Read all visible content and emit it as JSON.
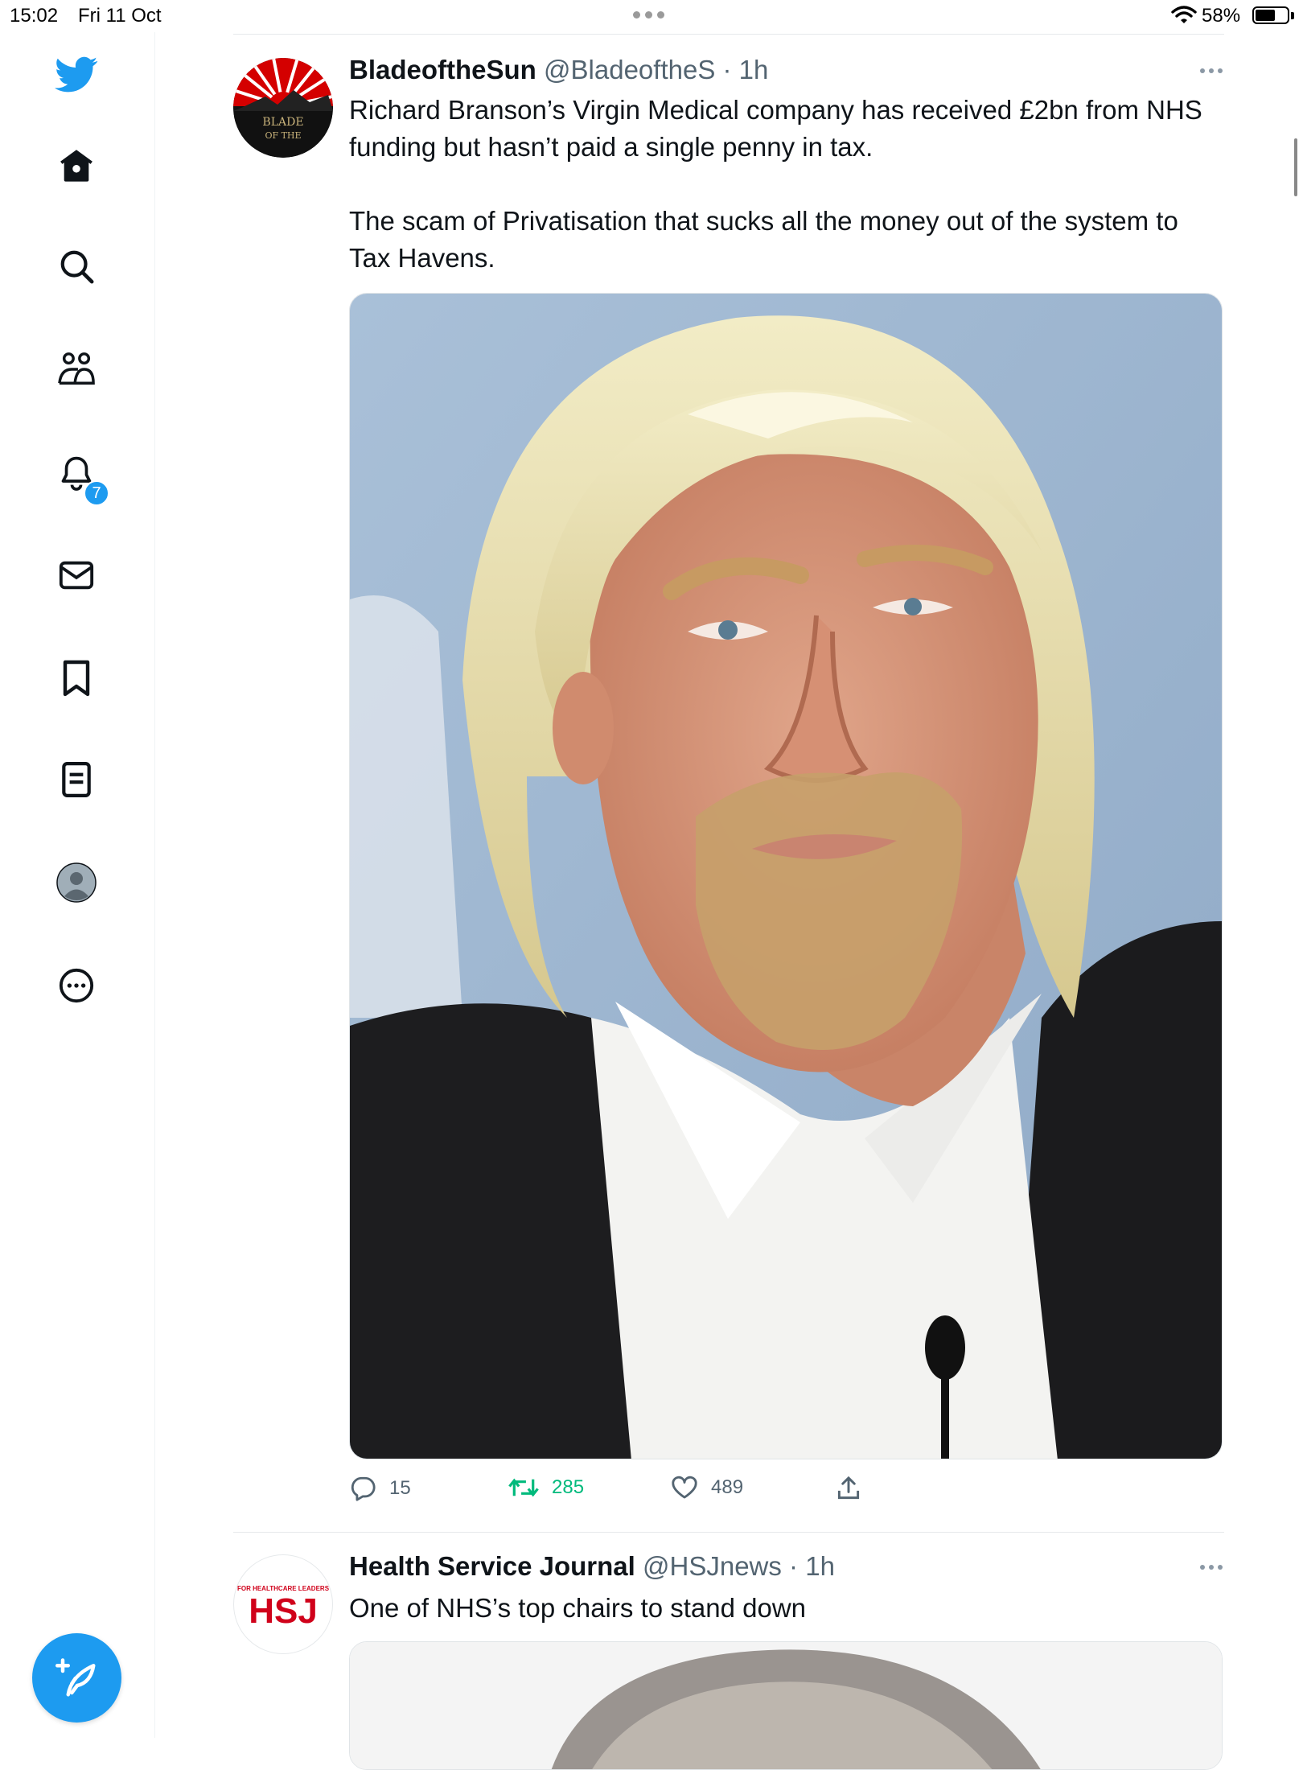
{
  "status_bar": {
    "time": "15:02",
    "date": "Fri 11 Oct",
    "battery": "58%"
  },
  "sidebar": {
    "items": [
      {
        "name": "home",
        "icon": "home-icon"
      },
      {
        "name": "explore",
        "icon": "search-icon"
      },
      {
        "name": "communities",
        "icon": "communities-icon"
      },
      {
        "name": "notifications",
        "icon": "bell-icon",
        "badge": "7"
      },
      {
        "name": "messages",
        "icon": "mail-icon"
      },
      {
        "name": "bookmarks",
        "icon": "bookmark-icon"
      },
      {
        "name": "lists",
        "icon": "lists-icon"
      },
      {
        "name": "profile",
        "icon": "avatar-icon"
      },
      {
        "name": "more",
        "icon": "more-icon"
      }
    ],
    "brand_color": "#1d9bf0"
  },
  "tweets": [
    {
      "display_name": "BladeoftheSun",
      "handle": "@BladeoftheS",
      "time": "1h",
      "avatar_text": "BLADE\nOF THE",
      "text": "Richard Branson’s Virgin Medical company has received £2bn from NHS funding but hasn’t paid a single penny in tax.\n\nThe scam of Privatisation that sucks all the money out of the system to Tax Havens.",
      "stats": {
        "replies": "15",
        "retweets": "285",
        "likes": "489"
      }
    },
    {
      "display_name": "Health Service Journal",
      "handle": "@HSJnews",
      "time": "1h",
      "avatar_text": "HSJ",
      "avatar_small_text": "FOR HEALTHCARE LEADERS",
      "text": "One of NHS’s top chairs to stand down"
    }
  ],
  "colors": {
    "retweet_green": "#00ba7c",
    "text_secondary": "#536471"
  }
}
